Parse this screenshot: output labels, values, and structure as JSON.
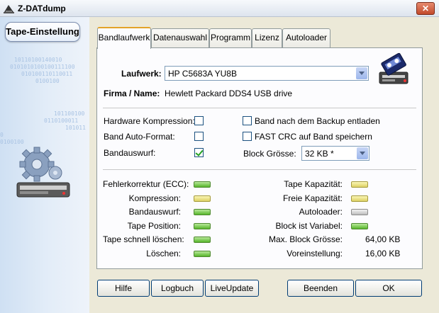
{
  "window": {
    "title": "Z-DATdump",
    "close_symbol": "✕"
  },
  "left_panel": {
    "tab_label": "Tape-Einstellung",
    "binary_lines": [
      "10110100140010",
      "0101010100100111100",
      "010100110110011",
      "0100100",
      "101100100",
      "0110100011",
      "101011",
      "0100100",
      "0"
    ]
  },
  "tabs": [
    {
      "label": "Bandlaufwerk",
      "active": true
    },
    {
      "label": "Datenauswahl",
      "active": false
    },
    {
      "label": "Programm",
      "active": false
    },
    {
      "label": "Lizenz",
      "active": false
    },
    {
      "label": "Autoloader",
      "active": false
    }
  ],
  "drive": {
    "laufwerk_label": "Laufwerk:",
    "laufwerk_value": "HP C5683A YU8B",
    "firma_label": "Firma / Name:",
    "firma_value": "Hewlett Packard DDS4 USB drive"
  },
  "options": {
    "hw_compression_label": "Hardware Kompression:",
    "hw_compression_checked": false,
    "auto_format_label": "Band Auto-Format:",
    "auto_format_checked": false,
    "eject_label": "Bandauswurf:",
    "eject_checked": true,
    "unload_label": "Band nach dem Backup entladen",
    "unload_checked": false,
    "fastcrc_label": "FAST CRC auf Band speichern",
    "fastcrc_checked": false,
    "block_size_label": "Block Grösse:",
    "block_size_value": "32 KB *"
  },
  "status_left": [
    {
      "label": "Fehlerkorrektur (ECC):",
      "color": "green"
    },
    {
      "label": "Kompression:",
      "color": "yellow"
    },
    {
      "label": "Bandauswurf:",
      "color": "green"
    },
    {
      "label": "Tape Position:",
      "color": "green"
    },
    {
      "label": "Tape schnell löschen:",
      "color": "green"
    },
    {
      "label": "Löschen:",
      "color": "green"
    }
  ],
  "status_right": [
    {
      "label": "Tape Kapazität:",
      "color": "yellow"
    },
    {
      "label": "Freie Kapazität:",
      "color": "yellow"
    },
    {
      "label": "Autoloader:",
      "color": "gray"
    },
    {
      "label": "Block ist Variabel:",
      "color": "green"
    }
  ],
  "status_values": {
    "max_block_label": "Max. Block Grösse:",
    "max_block_value": "64,00 KB",
    "default_label": "Voreinstellung:",
    "default_value": "16,00 KB"
  },
  "buttons": {
    "hilfe": "Hilfe",
    "logbuch": "Logbuch",
    "liveupdate": "LiveUpdate",
    "beenden": "Beenden",
    "ok": "OK"
  },
  "colors": {
    "led_green": "#56b52a",
    "led_yellow": "#ddd164",
    "led_gray": "#bdbdbd",
    "active_tab_accent": "#e3a32a"
  }
}
